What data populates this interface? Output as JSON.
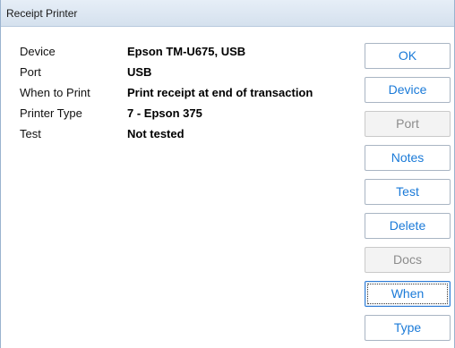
{
  "window": {
    "title": "Receipt Printer"
  },
  "properties": [
    {
      "label": "Device",
      "value": "Epson TM-U675, USB"
    },
    {
      "label": "Port",
      "value": "USB"
    },
    {
      "label": "When to Print",
      "value": "Print receipt at end of transaction"
    },
    {
      "label": "Printer Type",
      "value": "7 - Epson 375"
    },
    {
      "label": "Test",
      "value": "Not tested"
    }
  ],
  "buttons": {
    "ok": {
      "label": "OK",
      "enabled": true
    },
    "device": {
      "label": "Device",
      "enabled": true
    },
    "port": {
      "label": "Port",
      "enabled": false
    },
    "notes": {
      "label": "Notes",
      "enabled": true
    },
    "test": {
      "label": "Test",
      "enabled": true
    },
    "delete": {
      "label": "Delete",
      "enabled": true
    },
    "docs": {
      "label": "Docs",
      "enabled": false
    },
    "when": {
      "label": "When",
      "enabled": true,
      "focused": true
    },
    "type": {
      "label": "Type",
      "enabled": true
    }
  },
  "colors": {
    "button_text": "#1a7ad8",
    "disabled_text": "#8c8c8c",
    "titlebar": "#dce6f1"
  }
}
